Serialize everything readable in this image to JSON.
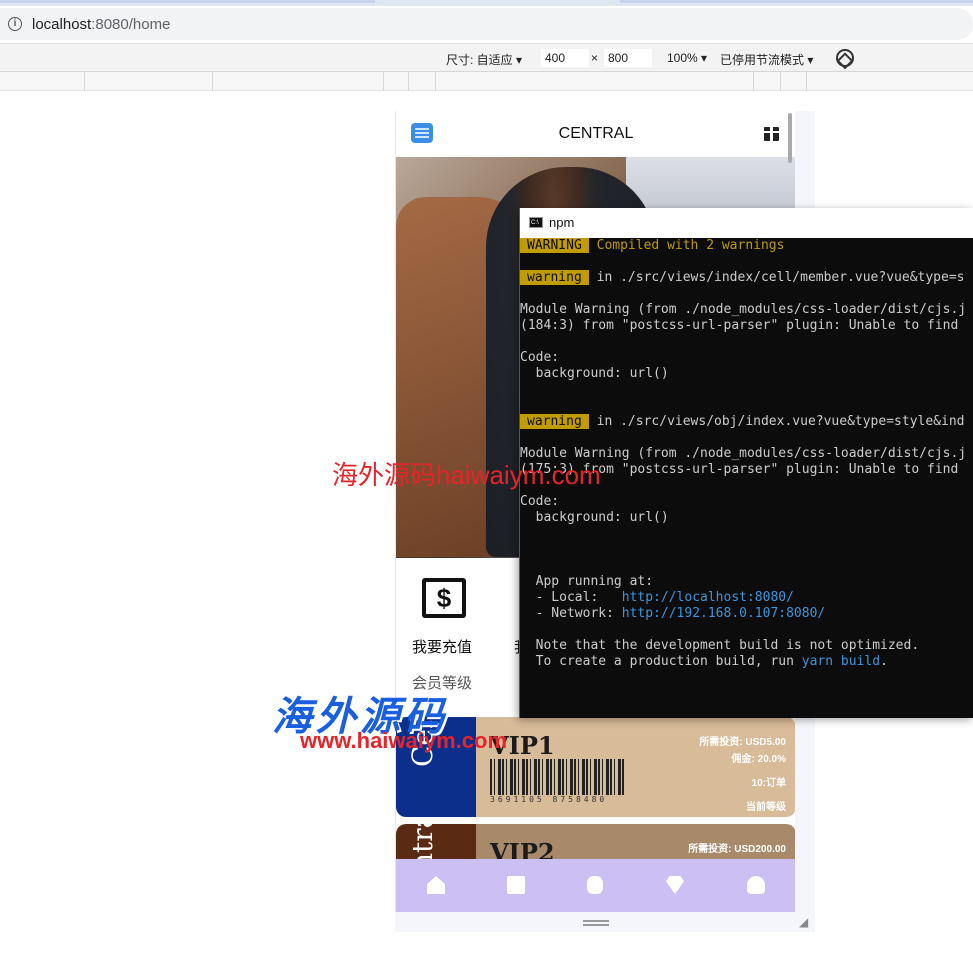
{
  "browser": {
    "url_host": "localhost",
    "url_path": ":8080/home"
  },
  "devtools": {
    "size_label": "尺寸: 自适应 ▾",
    "width": "400",
    "times": "×",
    "height": "800",
    "zoom": "100% ▾",
    "throttle": "已停用节流模式 ▾"
  },
  "app": {
    "title": "CENTRAL",
    "actions": {
      "recharge": "我要充值",
      "withdraw": "我"
    },
    "level_title": "会员等级",
    "vip_cards": [
      {
        "side_text": "Central",
        "name": "VIP1",
        "investment": "所需投资:  USD5.00",
        "commission": "佣金:  20.0%",
        "orders": "10:订单",
        "status": "当前等级",
        "barcode_number": "3691105 8758480",
        "side_color": "#0b2f8a",
        "body_color": "#d8bb98"
      },
      {
        "side_text": "Central",
        "name": "VIP2",
        "investment": "所需投资:  USD200.00",
        "side_color": "#5a2a12",
        "body_color": "#a88a6a"
      }
    ],
    "tab_icons": [
      "home-icon",
      "orders-icon",
      "tap-icon",
      "vip-icon",
      "user-icon"
    ],
    "tabbar_color": "#cbbff3"
  },
  "console": {
    "title": "npm",
    "lines": [
      {
        "badge": "WARNING",
        "text": " Compiled with 2 warnings",
        "style": "yel"
      },
      {
        "badge": "warning",
        "text": " in ./src/views/index/cell/member.vue?vue&type=s"
      },
      {
        "text": "Module Warning (from ./node_modules/css-loader/dist/cjs.j"
      },
      {
        "text": "(184:3) from \"postcss-url-parser\" plugin: Unable to find"
      },
      {
        "text": "Code:"
      },
      {
        "text": "  background: url()"
      },
      {
        "badge": "warning",
        "text": " in ./src/views/obj/index.vue?vue&type=style&ind"
      },
      {
        "text": "Module Warning (from ./node_modules/css-loader/dist/cjs.j"
      },
      {
        "text": "(175:3) from \"postcss-url-parser\" plugin: Unable to find"
      },
      {
        "text": "Code:"
      },
      {
        "text": "  background: url()"
      },
      {
        "text": "  App running at:"
      },
      {
        "text": "  - Local:   ",
        "link": "http://localhost:8080/"
      },
      {
        "text": "  - Network: ",
        "link": "http://192.168.0.107:8080/"
      },
      {
        "text": "  Note that the development build is not optimized."
      },
      {
        "text": "  To create a production build, run ",
        "link": "yarn build",
        "tail": "."
      }
    ]
  },
  "watermarks": {
    "red_line": "海外源码haiwaiym.com",
    "big_text": "海外源码",
    "url": "www.haiwaiym.com"
  }
}
